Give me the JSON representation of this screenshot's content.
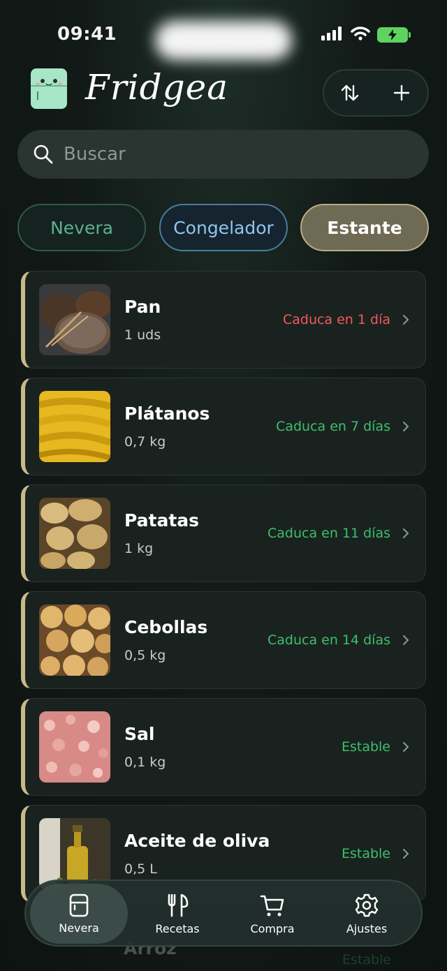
{
  "status_bar": {
    "time": "09:41"
  },
  "header": {
    "app_title": "Fridgea"
  },
  "search": {
    "placeholder": "Buscar"
  },
  "tabs": [
    {
      "label": "Nevera",
      "color": "#5fae94"
    },
    {
      "label": "Congelador",
      "color": "#8fc7ea"
    },
    {
      "label": "Estante",
      "color": "#ffffff",
      "selected": true
    }
  ],
  "items": [
    {
      "name": "Pan",
      "quantity": "1 uds",
      "status": "Caduca en 1 día",
      "status_color": "#ef5b5b"
    },
    {
      "name": "Plátanos",
      "quantity": "0,7 kg",
      "status": "Caduca en 7 días",
      "status_color": "#3fbf6a"
    },
    {
      "name": "Patatas",
      "quantity": "1 kg",
      "status": "Caduca en 11 días",
      "status_color": "#3fbf6a"
    },
    {
      "name": "Cebollas",
      "quantity": "0,5 kg",
      "status": "Caduca en 14 días",
      "status_color": "#3fbf6a"
    },
    {
      "name": "Sal",
      "quantity": "0,1 kg",
      "status": "Estable",
      "status_color": "#3fbf6a"
    },
    {
      "name": "Aceite de oliva",
      "quantity": "0,5 L",
      "status": "Estable",
      "status_color": "#3fbf6a"
    }
  ],
  "partial_item": {
    "name": "Arroz",
    "status": "Estable"
  },
  "nav": [
    {
      "label": "Nevera",
      "icon": "fridge-icon",
      "active": true
    },
    {
      "label": "Recetas",
      "icon": "fork-knife-icon"
    },
    {
      "label": "Compra",
      "icon": "cart-icon"
    },
    {
      "label": "Ajustes",
      "icon": "gear-icon"
    }
  ],
  "colors": {
    "accent": "#c8b988",
    "expiring": "#ef5b5b",
    "fresh": "#3fbf6a"
  }
}
